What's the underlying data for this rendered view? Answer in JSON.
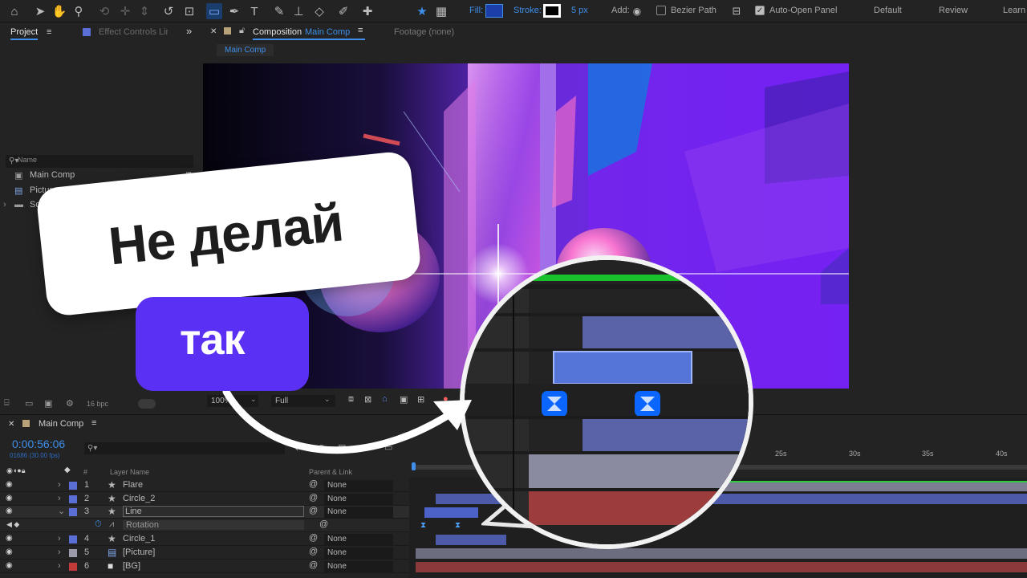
{
  "toolbar": {
    "fill_label": "Fill:",
    "stroke_label": "Stroke:",
    "stroke_width": "5 px",
    "add_label": "Add:",
    "bezier_path_label": "Bezier Path",
    "auto_open_panel_label": "Auto-Open Panel",
    "workspaces": [
      "Default",
      "Review",
      "Learn"
    ],
    "colors": {
      "fill": "#1b3ea8",
      "stroke": "#ffffff",
      "accent": "#3f8ee9"
    }
  },
  "project_panel": {
    "tab_project": "Project",
    "tab_effect_controls": "Effect Controls Lir",
    "search_glyph": "⚲▾",
    "column_name": "Name",
    "items": [
      {
        "label": "Main Comp",
        "icon": "composition-icon"
      },
      {
        "label": "Picture",
        "icon": "image-file-icon"
      },
      {
        "label": "Solids",
        "icon": "folder-icon"
      }
    ],
    "bpc_label": "16 bpc"
  },
  "composition_panel": {
    "tab_prefix": "Composition",
    "tab_comp_name": "Main Comp",
    "footage_tab": "Footage  (none)",
    "breadcrumb": "Main Comp",
    "zoom": "100%",
    "resolution": "Full"
  },
  "timeline": {
    "tab_label": "Main Comp",
    "timecode": "0:00:56:06",
    "frame_info": "01686 (30.00 fps)",
    "col_layer_name": "Layer Name",
    "col_parent": "Parent & Link",
    "ruler_ticks": [
      "25s",
      "30s",
      "35s",
      "40s"
    ],
    "layers": [
      {
        "num": "1",
        "name": "Flare",
        "color": "#5b6ed6",
        "parent": "None"
      },
      {
        "num": "2",
        "name": "Circle_2",
        "color": "#5b6ed6",
        "parent": "None"
      },
      {
        "num": "3",
        "name": "Line",
        "color": "#5b6ed6",
        "parent": "None"
      },
      {
        "num": "4",
        "name": "Circle_1",
        "color": "#5b6ed6",
        "parent": "None"
      },
      {
        "num": "5",
        "name": "[Picture]",
        "color": "#9a9aaa",
        "parent": "None"
      },
      {
        "num": "6",
        "name": "[BG]",
        "color": "#c23a3a",
        "parent": "None"
      }
    ],
    "property_label": "Rotation"
  },
  "callouts": {
    "top_text": "Не делай",
    "bottom_text": "так",
    "purple_color": "#5a31f4"
  }
}
